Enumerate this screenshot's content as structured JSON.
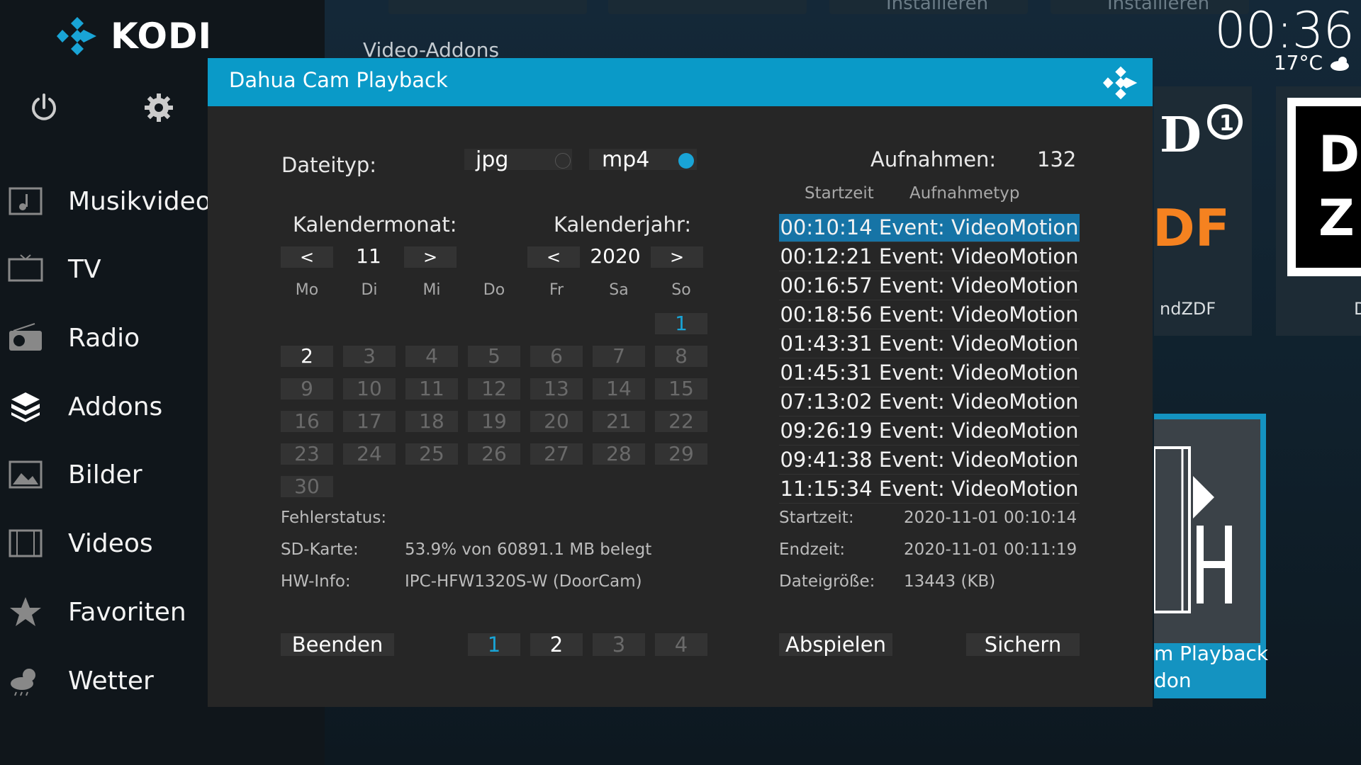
{
  "app": {
    "name": "KODI"
  },
  "clock": {
    "time": "00:36",
    "temperature": "17°C",
    "weather_icon": "cloud-icon"
  },
  "background": {
    "section_title": "Video-Addons",
    "tile_labels": [
      "Installieren",
      "Installieren"
    ],
    "posters": [
      {
        "label": "ndZDF"
      },
      {
        "label": "D"
      },
      {
        "label_line1": "m Playback",
        "label_line2": "don"
      }
    ]
  },
  "sidebar": {
    "items": [
      {
        "label": "Musikvideos",
        "icon": "music-video-icon"
      },
      {
        "label": "TV",
        "icon": "tv-icon"
      },
      {
        "label": "Radio",
        "icon": "radio-icon"
      },
      {
        "label": "Addons",
        "icon": "addons-box-icon"
      },
      {
        "label": "Bilder",
        "icon": "pictures-icon"
      },
      {
        "label": "Videos",
        "icon": "film-icon"
      },
      {
        "label": "Favoriten",
        "icon": "star-icon"
      },
      {
        "label": "Wetter",
        "icon": "weather-icon"
      }
    ]
  },
  "dialog": {
    "title": "Dahua Cam Playback",
    "filetype": {
      "label": "Dateityp:",
      "options": [
        {
          "label": "jpg",
          "selected": false
        },
        {
          "label": "mp4",
          "selected": true
        }
      ]
    },
    "calendar": {
      "month_label": "Kalendermonat:",
      "year_label": "Kalenderjahr:",
      "prev": "<",
      "next": ">",
      "month": "11",
      "year": "2020",
      "weekdays": [
        "Mo",
        "Di",
        "Mi",
        "Do",
        "Fr",
        "Sa",
        "So"
      ],
      "days": [
        "1",
        "2",
        "3",
        "4",
        "5",
        "6",
        "7",
        "8",
        "9",
        "10",
        "11",
        "12",
        "13",
        "14",
        "15",
        "16",
        "17",
        "18",
        "19",
        "20",
        "21",
        "22",
        "23",
        "24",
        "25",
        "26",
        "27",
        "28",
        "29",
        "30"
      ],
      "selected_day": "1",
      "active_day": "2"
    },
    "status": {
      "error_label": "Fehlerstatus:",
      "error_value": "",
      "sd_label": "SD-Karte:",
      "sd_value": "53.9% von 60891.1 MB belegt",
      "hw_label": "HW-Info:",
      "hw_value": "IPC-HFW1320S-W (DoorCam)"
    },
    "recordings": {
      "label": "Aufnahmen:",
      "count": "132",
      "col_start": "Startzeit",
      "col_type": "Aufnahmetyp",
      "items": [
        "00:10:14 Event: VideoMotion",
        "00:12:21 Event: VideoMotion",
        "00:16:57 Event: VideoMotion",
        "00:18:56 Event: VideoMotion",
        "01:43:31 Event: VideoMotion",
        "01:45:31 Event: VideoMotion",
        "07:13:02 Event: VideoMotion",
        "09:26:19 Event: VideoMotion",
        "09:41:38 Event: VideoMotion",
        "11:15:34 Event: VideoMotion"
      ],
      "selected_index": 0
    },
    "details": {
      "start_label": "Startzeit:",
      "start_value": "2020-11-01 00:10:14",
      "end_label": "Endzeit:",
      "end_value": "2020-11-01 00:11:19",
      "size_label": "Dateigröße:",
      "size_value": "13443 (KB)"
    },
    "buttons": {
      "quit": "Beenden",
      "play": "Abspielen",
      "save": "Sichern"
    },
    "pages": {
      "items": [
        "1",
        "2",
        "3",
        "4"
      ],
      "current": "1",
      "active": "2"
    }
  },
  "colors": {
    "accent": "#0a9ac8",
    "selected_row": "#1674a6",
    "radio_on": "#19a4d6"
  }
}
